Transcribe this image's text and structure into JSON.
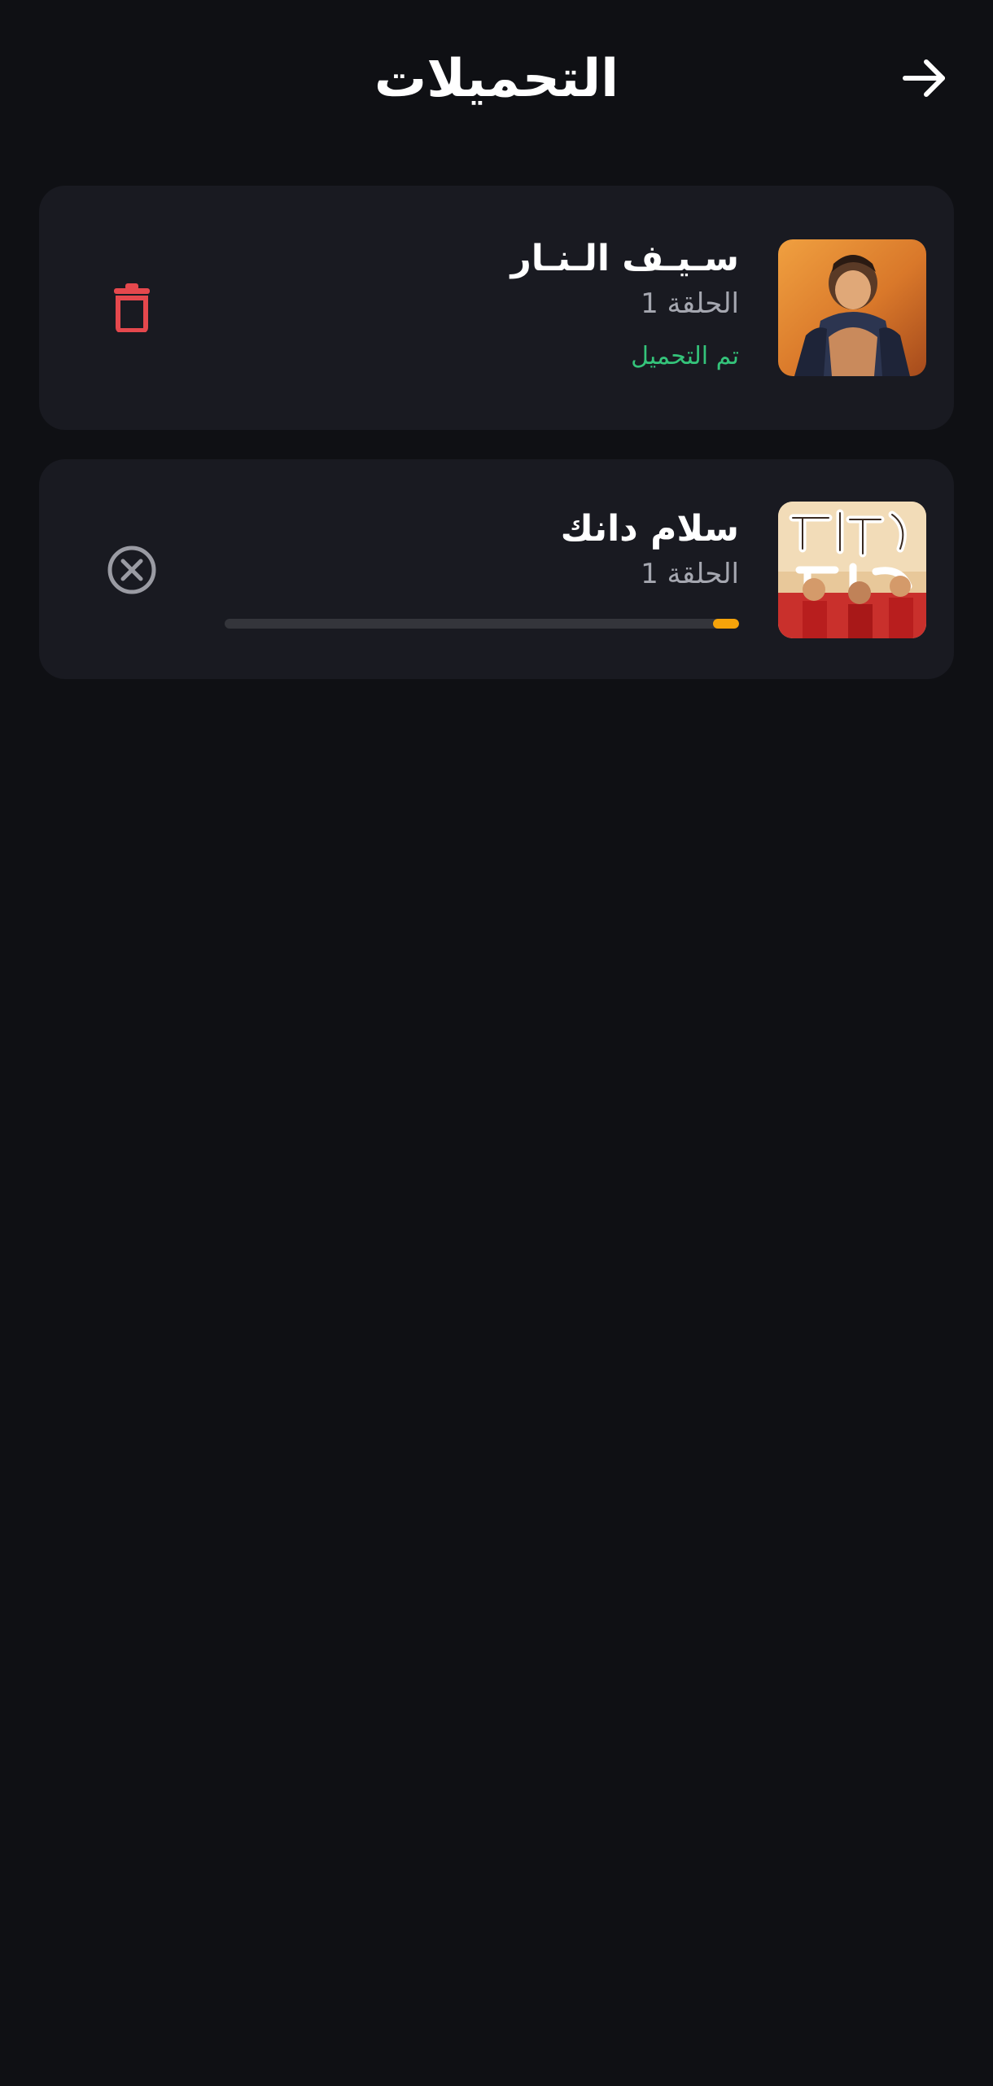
{
  "header": {
    "title": "التحميلات"
  },
  "downloads": [
    {
      "title": "سـيـف الـنـار",
      "episode": "الحلقة 1",
      "status": "تم التحميل",
      "status_color": "#34c37a",
      "action_icon": "trash-icon",
      "action_color": "#e5484d"
    },
    {
      "title": "سلام دانك",
      "episode": "الحلقة 1",
      "progress": 0.05,
      "progress_color": "#f5a30a",
      "action_icon": "cancel-circle-icon",
      "action_color": "#9a9ba3"
    }
  ],
  "colors": {
    "background": "#0f1014",
    "card": "#191a21",
    "text_primary": "#ffffff",
    "text_secondary": "#a5a7b0"
  }
}
